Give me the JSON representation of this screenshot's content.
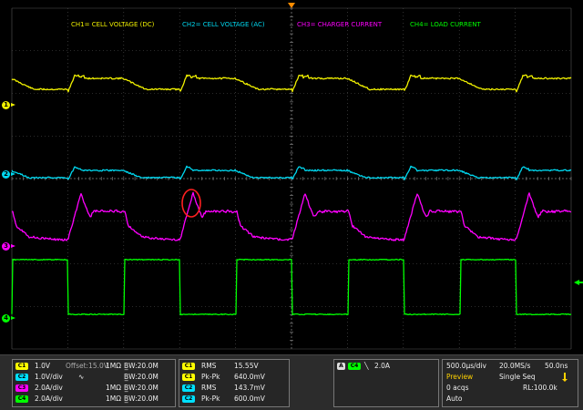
{
  "channels": {
    "ch1": {
      "label": "CH1= CELL VOLTAGE (DC)",
      "num": "1",
      "color": "#f0f000"
    },
    "ch2": {
      "label": "CH2= CELL VOLTAGE (AC)",
      "num": "2",
      "color": "#00d8f0"
    },
    "ch3": {
      "label": "CH3= CHARGER CURRENT",
      "num": "3",
      "color": "#ff00ff"
    },
    "ch4": {
      "label": "CH4= LOAD CURRENT",
      "num": "4",
      "color": "#00ff00"
    }
  },
  "vertical": [
    {
      "badge": "C1",
      "scale": "1.0V",
      "offset": "Offset:15.0V",
      "imp": "1MΩ",
      "bw": "B̲W:20.0M"
    },
    {
      "badge": "C2",
      "scale": "1.0V/div",
      "offset": "",
      "coupling": "∿",
      "imp": "",
      "bw": "B̲W:20.0M"
    },
    {
      "badge": "C3",
      "scale": "2.0A/div",
      "offset": "",
      "imp": "1MΩ",
      "bw": "B̲W:20.0M"
    },
    {
      "badge": "C4",
      "scale": "2.0A/div",
      "offset": "",
      "imp": "1MΩ",
      "bw": "B̲W:20.0M"
    }
  ],
  "measurements": [
    {
      "badge": "C1",
      "name": "RMS",
      "value": "15.55V"
    },
    {
      "badge": "C1",
      "name": "Pk-Pk",
      "value": "640.0mV"
    },
    {
      "badge": "C2",
      "name": "RMS",
      "value": "143.7mV"
    },
    {
      "badge": "C2",
      "name": "Pk-Pk",
      "value": "600.0mV"
    }
  ],
  "trigger": {
    "mode": "A",
    "source": "C4",
    "slope": "╲",
    "level": "2.0A"
  },
  "acquisition": {
    "timebase": "500.0μs/div",
    "sample_rate": "20.0MS/s",
    "record_time": "50.0ns",
    "state": "Preview",
    "seq": "Single Seq",
    "acqs": "0 acqs",
    "record_length": "RL:100.0k",
    "run": "Auto"
  },
  "colors": {
    "ch1": "#f0f000",
    "ch2": "#00d8f0",
    "ch3": "#ff00ff",
    "ch4": "#00ff00",
    "annotation": "#ff2020"
  }
}
